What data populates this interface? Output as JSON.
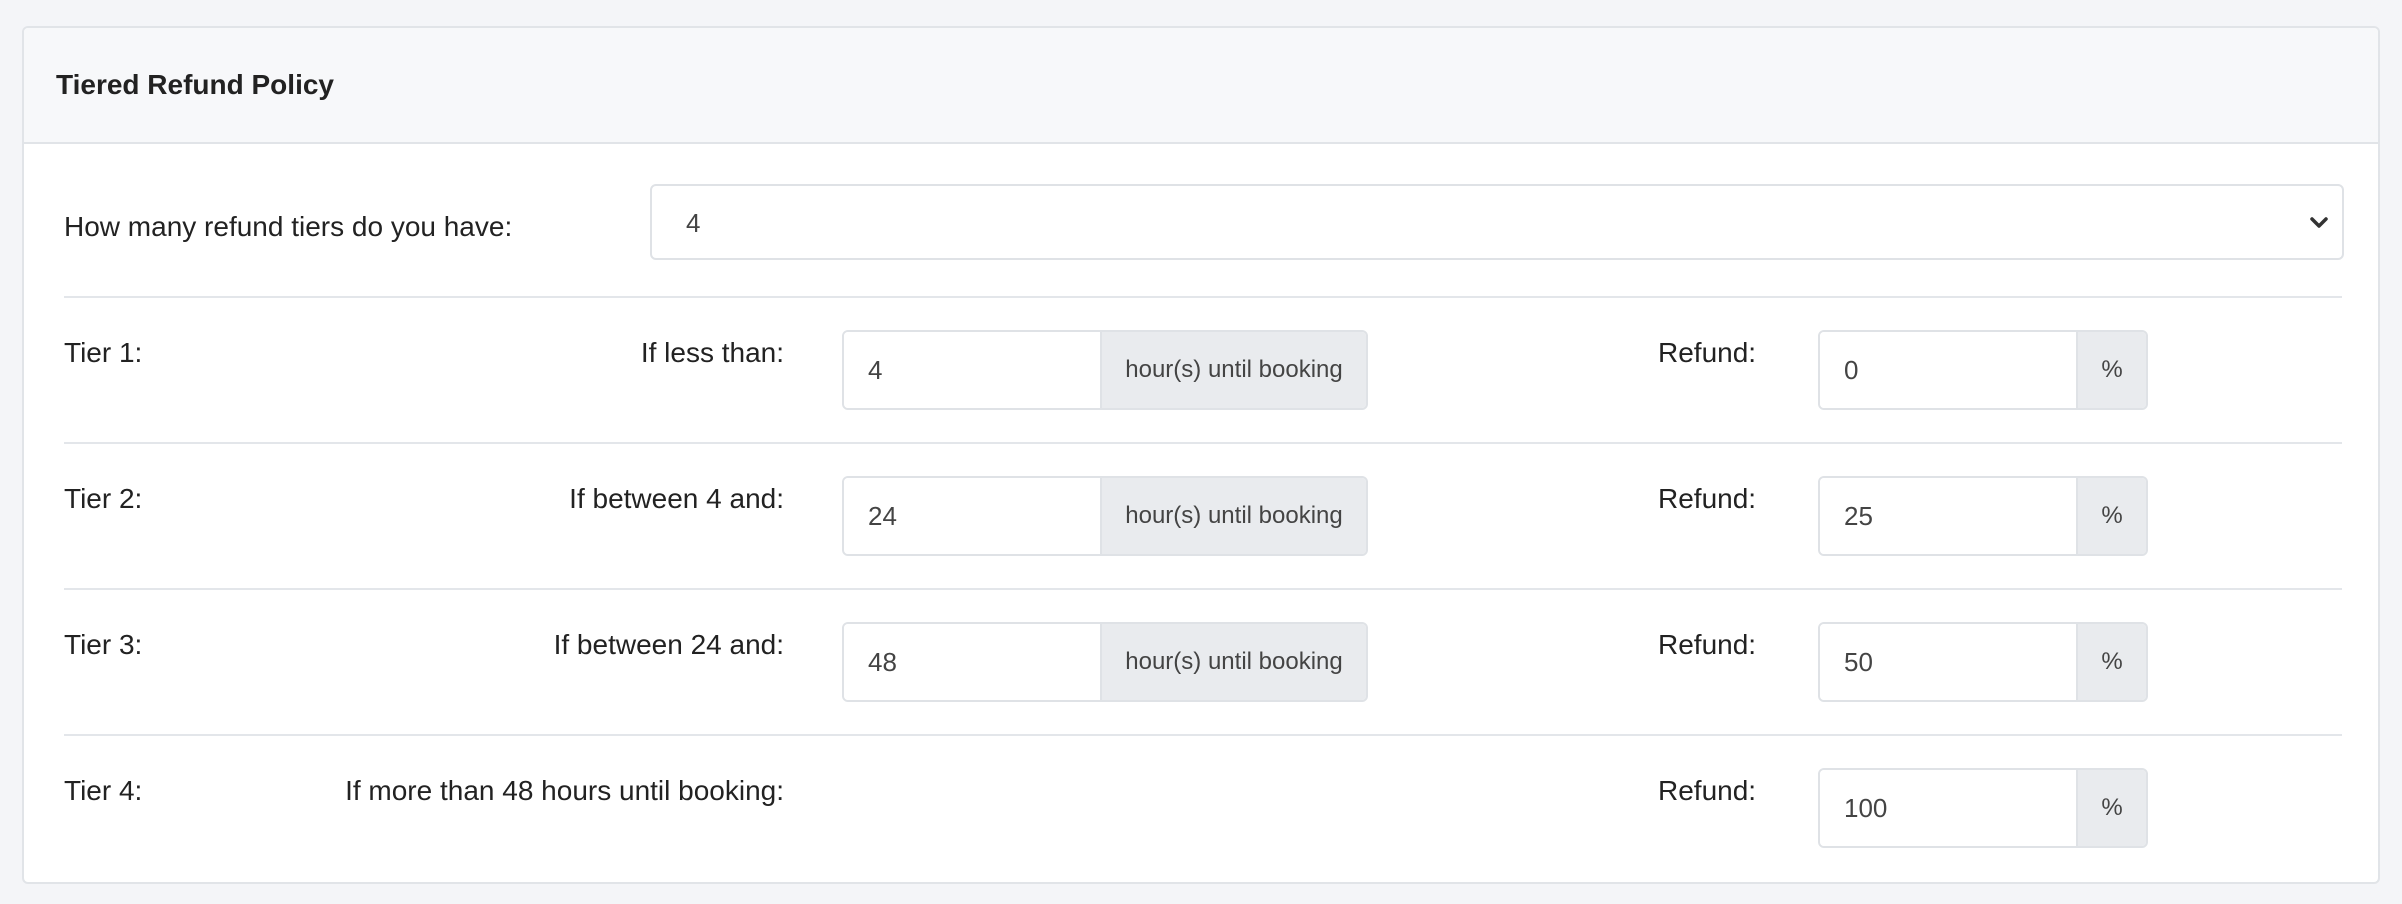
{
  "panel": {
    "title": "Tiered Refund Policy"
  },
  "tier_count": {
    "label": "How many refund tiers do you have:",
    "value": "4"
  },
  "refund_label": "Refund:",
  "hours_addon": "hour(s) until booking",
  "percent_addon": "%",
  "tiers": [
    {
      "label": "Tier 1:",
      "condition": "If less than:",
      "hours": "4",
      "refund": "0"
    },
    {
      "label": "Tier 2:",
      "condition": "If between 4 and:",
      "hours": "24",
      "refund": "25"
    },
    {
      "label": "Tier 3:",
      "condition": "If between 24 and:",
      "hours": "48",
      "refund": "50"
    },
    {
      "label": "Tier 4:",
      "condition": "If more than 48 hours until booking:",
      "refund": "100"
    }
  ]
}
